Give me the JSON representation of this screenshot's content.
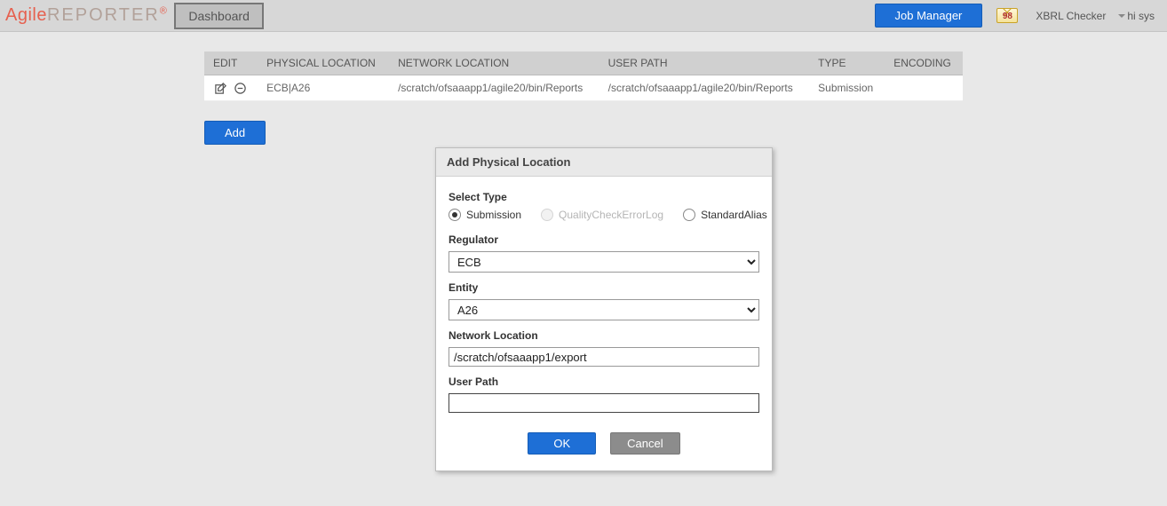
{
  "header": {
    "logo_agile": "Agile",
    "logo_reporter": "REPORTER",
    "logo_reg": "®",
    "dashboard": "Dashboard",
    "job_manager": "Job Manager",
    "mail_count": "98",
    "xbrl": "XBRL Checker",
    "user": "hi sys"
  },
  "table": {
    "headers": {
      "edit": "EDIT",
      "physical": "PHYSICAL LOCATION",
      "network": "NETWORK LOCATION",
      "userpath": "USER PATH",
      "type": "TYPE",
      "encoding": "ENCODING"
    },
    "rows": [
      {
        "physical": "ECB|A26",
        "network": "/scratch/ofsaaapp1/agile20/bin/Reports",
        "userpath": "/scratch/ofsaaapp1/agile20/bin/Reports",
        "type": "Submission",
        "encoding": ""
      }
    ]
  },
  "buttons": {
    "add": "Add"
  },
  "dialog": {
    "title": "Add Physical Location",
    "select_type_label": "Select Type",
    "types": {
      "submission": "Submission",
      "qce": "QualityCheckErrorLog",
      "alias": "StandardAlias"
    },
    "regulator_label": "Regulator",
    "regulator_value": "ECB",
    "entity_label": "Entity",
    "entity_value": "A26",
    "network_label": "Network Location",
    "network_value": "/scratch/ofsaaapp1/export",
    "userpath_label": "User Path",
    "userpath_value": "",
    "ok": "OK",
    "cancel": "Cancel"
  }
}
